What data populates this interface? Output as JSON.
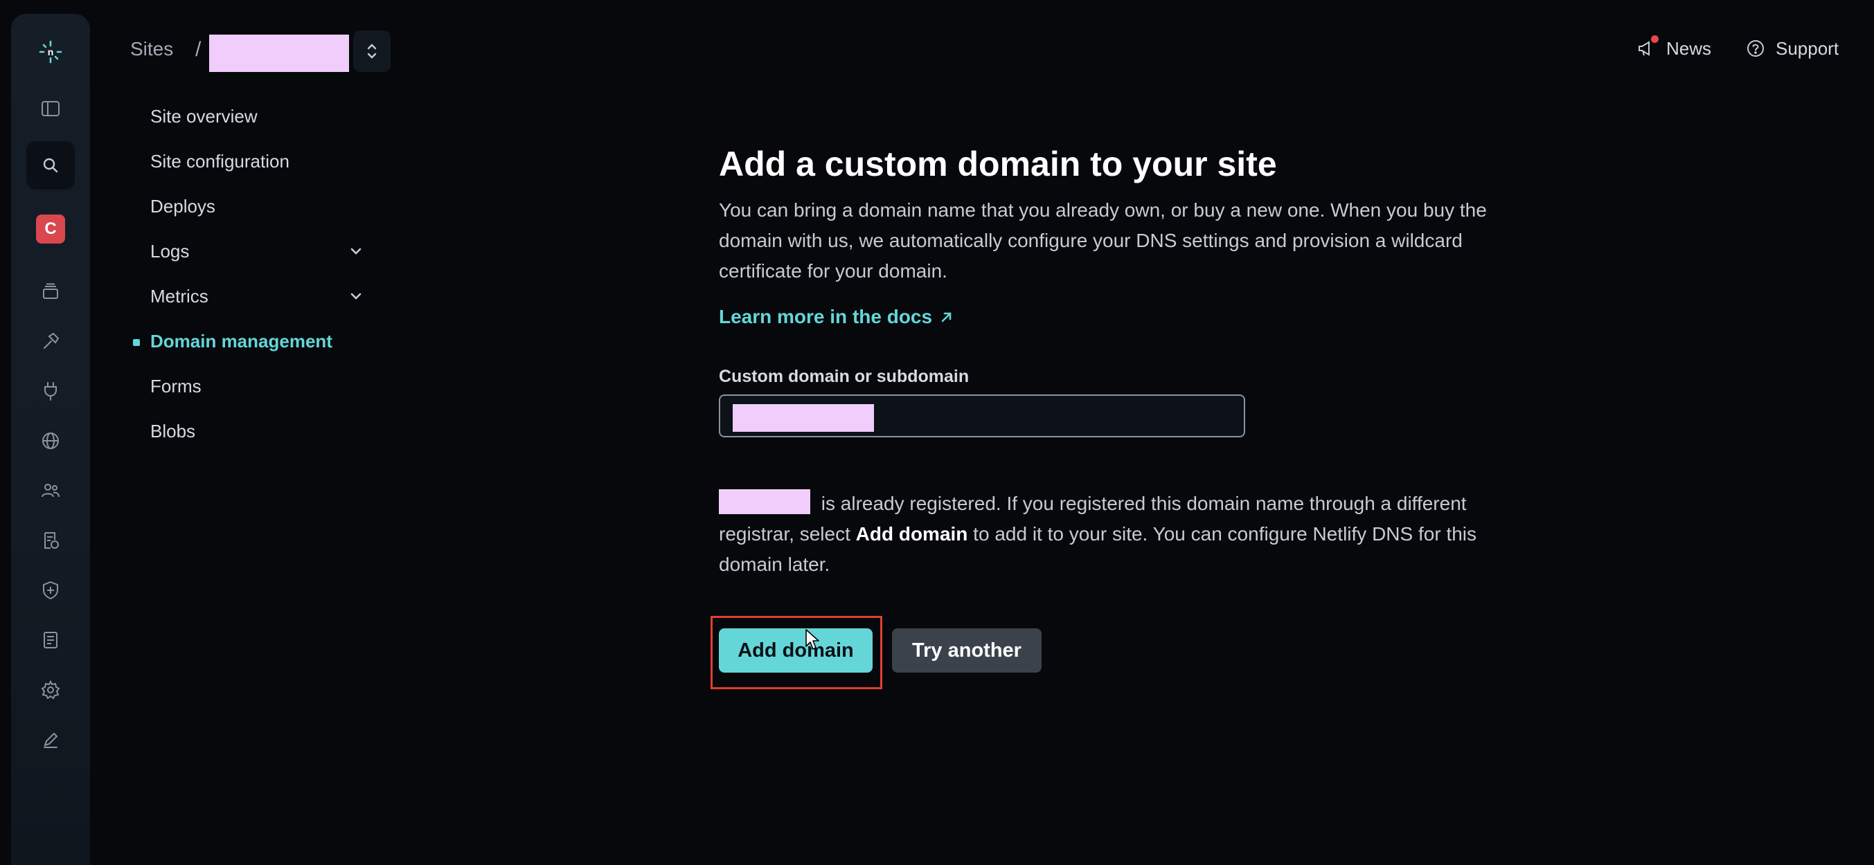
{
  "header": {
    "breadcrumb_root": "Sites",
    "breadcrumb_separator": "/",
    "news_label": "News",
    "support_label": "Support"
  },
  "rail": {
    "avatar_letter": "C",
    "icons": [
      "netlify-logo-icon",
      "sidebar-toggle-icon",
      "search-icon",
      "team-avatar",
      "projects-icon",
      "builds-icon",
      "integrations-icon",
      "domains-icon",
      "members-icon",
      "audit-log-icon",
      "security-icon",
      "billing-icon",
      "settings-icon",
      "edit-icon"
    ]
  },
  "sidenav": {
    "items": [
      {
        "label": "Site overview"
      },
      {
        "label": "Site configuration"
      },
      {
        "label": "Deploys"
      },
      {
        "label": "Logs",
        "expandable": true
      },
      {
        "label": "Metrics",
        "expandable": true
      },
      {
        "label": "Domain management",
        "active": true
      },
      {
        "label": "Forms"
      },
      {
        "label": "Blobs"
      }
    ]
  },
  "main": {
    "title": "Add a custom domain to your site",
    "description": "You can bring a domain name that you already own, or buy a new one. When you buy the domain with us, we automatically configure your DNS settings and provision a wildcard certificate for your domain.",
    "learn_more": "Learn more in the docs",
    "field_label": "Custom domain or subdomain",
    "registered_prefix": " is already registered. If you registered this domain name through a different registrar, select ",
    "registered_bold": "Add domain",
    "registered_suffix": " to add it to your site. You can configure Netlify DNS for this domain later.",
    "primary_button": "Add domain",
    "secondary_button": "Try another"
  },
  "colors": {
    "accent": "#64d6d8",
    "background": "#06080c",
    "highlight_border": "#e13f2f",
    "redaction": "#f0cdfa"
  }
}
